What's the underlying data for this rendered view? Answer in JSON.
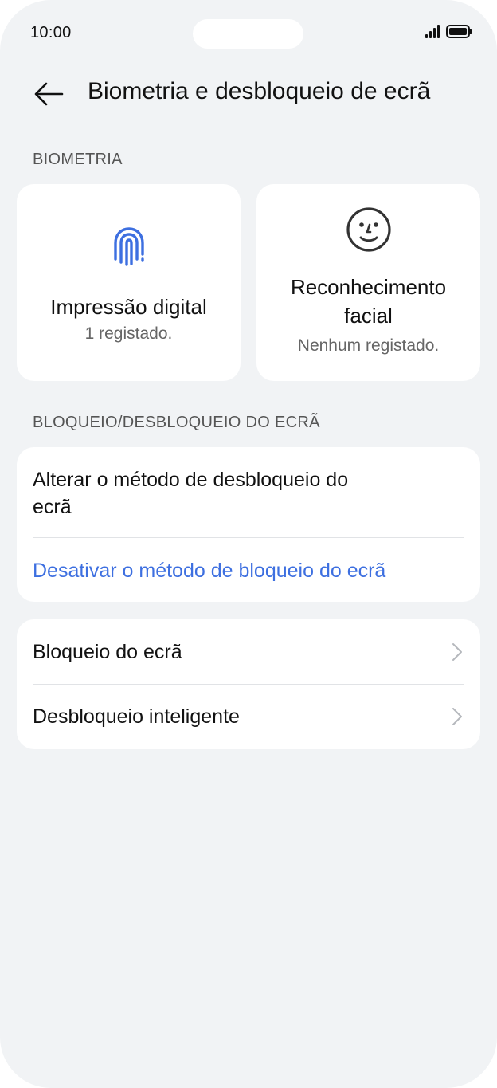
{
  "status_bar": {
    "time": "10:00"
  },
  "header": {
    "title": "Biometria e desbloqueio de ecrã"
  },
  "biometrics": {
    "section_label": "BIOMETRIA",
    "fingerprint": {
      "title": "Impressão digital",
      "subtitle": "1 registado."
    },
    "face": {
      "title_line1": "Reconhecimento",
      "title_line2": "facial",
      "subtitle": "Nenhum registado."
    }
  },
  "lock": {
    "section_label": "BLOQUEIO/DESBLOQUEIO DO ECRÃ",
    "change_method_line1": "Alterar o método de desbloqueio do",
    "change_method_line2": "ecrã",
    "disable_method": "Desativar o método de bloqueio do ecrã"
  },
  "more": {
    "lock_screen": "Bloqueio do ecrã",
    "smart_unlock": "Desbloqueio inteligente"
  },
  "colors": {
    "accent": "#3d6fe0",
    "background": "#f1f3f5",
    "card": "#ffffff"
  },
  "icons": {
    "back": "arrow-left-icon",
    "fingerprint": "fingerprint-icon",
    "face": "smiley-face-icon",
    "chevron": "chevron-right-icon"
  }
}
